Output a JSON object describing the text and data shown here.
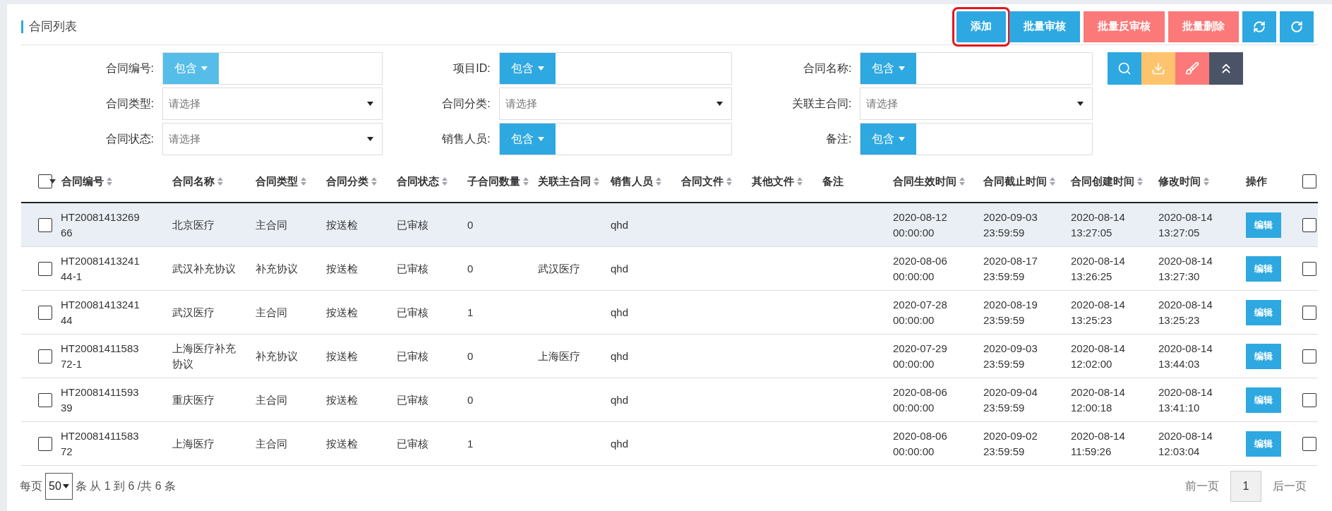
{
  "title": "合同列表",
  "toolbar": [
    {
      "kind": "primary",
      "label": "添加",
      "outlined": true
    },
    {
      "kind": "primary",
      "label": "批量审核",
      "outlined": false
    },
    {
      "kind": "danger",
      "label": "批量反审核",
      "outlined": false
    },
    {
      "kind": "danger",
      "label": "批量删除",
      "outlined": false
    },
    {
      "kind": "refresh",
      "outlined": false
    },
    {
      "kind": "redo",
      "outlined": false
    }
  ],
  "filters": [
    {
      "label": "合同编号:",
      "kind": "match",
      "match": "包含",
      "hovered": true
    },
    {
      "label": "项目ID:",
      "kind": "match",
      "match": "包含",
      "hovered": false
    },
    {
      "label": "合同名称:",
      "kind": "match",
      "match": "包含",
      "hovered": false
    },
    {
      "label": "合同类型:",
      "kind": "select",
      "placeholder": "请选择"
    },
    {
      "label": "合同分类:",
      "kind": "select",
      "placeholder": "请选择"
    },
    {
      "label": "关联主合同:",
      "kind": "select",
      "placeholder": "请选择"
    },
    {
      "label": "合同状态:",
      "kind": "select",
      "placeholder": "请选择"
    },
    {
      "label": "销售人员:",
      "kind": "match",
      "match": "包含",
      "hovered": false
    },
    {
      "label": "备注:",
      "kind": "match",
      "match": "包含",
      "hovered": false
    }
  ],
  "filter_actions": [
    {
      "kind": "search"
    },
    {
      "kind": "download"
    },
    {
      "kind": "clear"
    },
    {
      "kind": "collapse"
    }
  ],
  "table": {
    "header_checked": false,
    "columns": [
      {
        "label": "合同编号",
        "sortable": true,
        "sorted": true
      },
      {
        "label": "合同名称",
        "sortable": true,
        "sorted": false
      },
      {
        "label": "合同类型",
        "sortable": true,
        "sorted": false
      },
      {
        "label": "合同分类",
        "sortable": true,
        "sorted": false
      },
      {
        "label": "合同状态",
        "sortable": true,
        "sorted": false
      },
      {
        "label": "子合同数量",
        "sortable": true,
        "sorted": false
      },
      {
        "label": "关联主合同",
        "sortable": true,
        "sorted": false
      },
      {
        "label": "销售人员",
        "sortable": true,
        "sorted": false
      },
      {
        "label": "合同文件",
        "sortable": true,
        "sorted": false
      },
      {
        "label": "其他文件",
        "sortable": true,
        "sorted": false
      },
      {
        "label": "备注",
        "sortable": false,
        "sorted": false
      },
      {
        "label": "合同生效时间",
        "sortable": true,
        "sorted": false
      },
      {
        "label": "合同截止时间",
        "sortable": true,
        "sorted": false
      },
      {
        "label": "合同创建时间",
        "sortable": true,
        "sorted": false
      },
      {
        "label": "修改时间",
        "sortable": true,
        "sorted": false
      },
      {
        "label": "操作",
        "sortable": false,
        "sorted": false
      }
    ],
    "tail_checked": false,
    "rows": [
      {
        "checked": false,
        "tail_checked": false,
        "hovered": true,
        "cells": [
          "HT2008141326966",
          "北京医疗",
          "主合同",
          "按送检",
          "已审核",
          "0",
          "",
          "qhd",
          "",
          "",
          "",
          "2020-08-12 00:00:00",
          "2020-09-03 23:59:59",
          "2020-08-14 13:27:05",
          "2020-08-14 13:27:05"
        ],
        "action": "编辑"
      },
      {
        "checked": false,
        "tail_checked": false,
        "hovered": false,
        "cells": [
          "HT2008141324144-1",
          "武汉补充协议",
          "补充协议",
          "按送检",
          "已审核",
          "0",
          "武汉医疗",
          "qhd",
          "",
          "",
          "",
          "2020-08-06 00:00:00",
          "2020-08-17 23:59:59",
          "2020-08-14 13:26:25",
          "2020-08-14 13:27:30"
        ],
        "action": "编辑"
      },
      {
        "checked": false,
        "tail_checked": false,
        "hovered": false,
        "cells": [
          "HT2008141324144",
          "武汉医疗",
          "主合同",
          "按送检",
          "已审核",
          "1",
          "",
          "qhd",
          "",
          "",
          "",
          "2020-07-28 00:00:00",
          "2020-08-19 23:59:59",
          "2020-08-14 13:25:23",
          "2020-08-14 13:25:23"
        ],
        "action": "编辑"
      },
      {
        "checked": false,
        "tail_checked": false,
        "hovered": false,
        "cells": [
          "HT2008141158372-1",
          "上海医疗补充协议",
          "补充协议",
          "按送检",
          "已审核",
          "0",
          "上海医疗",
          "qhd",
          "",
          "",
          "",
          "2020-07-29 00:00:00",
          "2020-09-03 23:59:59",
          "2020-08-14 12:02:00",
          "2020-08-14 13:44:03"
        ],
        "action": "编辑"
      },
      {
        "checked": false,
        "tail_checked": false,
        "hovered": false,
        "cells": [
          "HT2008141159339",
          "重庆医疗",
          "主合同",
          "按送检",
          "已审核",
          "0",
          "",
          "qhd",
          "",
          "",
          "",
          "2020-08-06 00:00:00",
          "2020-09-04 23:59:59",
          "2020-08-14 12:00:18",
          "2020-08-14 13:41:10"
        ],
        "action": "编辑"
      },
      {
        "checked": false,
        "tail_checked": false,
        "hovered": false,
        "cells": [
          "HT2008141158372",
          "上海医疗",
          "主合同",
          "按送检",
          "已审核",
          "1",
          "",
          "qhd",
          "",
          "",
          "",
          "2020-08-06 00:00:00",
          "2020-09-02 23:59:59",
          "2020-08-14 11:59:26",
          "2020-08-14 12:03:04"
        ],
        "action": "编辑"
      }
    ]
  },
  "footer": {
    "per_page_label": "每页",
    "page_size": "50",
    "info": "条 从 1 到 6 /共 6 条",
    "prev": "前一页",
    "pages": [
      {
        "label": "1",
        "selected": true
      }
    ],
    "next": "后一页"
  }
}
